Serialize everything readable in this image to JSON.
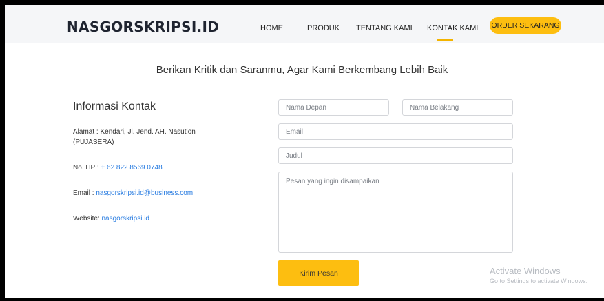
{
  "navbar": {
    "brand": "NASGORSKRIPSI.ID",
    "items": [
      "HOME",
      "PRODUK",
      "TENTANG KAMI",
      "KONTAK KAMI"
    ],
    "active": "KONTAK KAMI",
    "order_label": "ORDER SEKARANG",
    "accent_color": "#fdbe10"
  },
  "heading": "Berikan Kritik dan Saranmu, Agar Kami Berkembang Lebih Baik",
  "contact_info": {
    "title": "Informasi Kontak",
    "address_label": "Alamat : Kendari, Jl. Jend. AH. Nasution",
    "address_line2": "(PUJASERA)",
    "phone_label": "No. HP : ",
    "phone_value": "+ 62 822 8569 0748",
    "email_label": "Email : ",
    "email_value": "nasgorskripsi.id@business.com",
    "website_label": "Website: ",
    "website_value": "nasgorskripsi.id",
    "link_color": "#2a7de1"
  },
  "form": {
    "first_name_placeholder": "Nama Depan",
    "last_name_placeholder": "Nama Belakang",
    "email_placeholder": "Email",
    "subject_placeholder": "Judul",
    "message_placeholder": "Pesan yang ingin disampaikan",
    "submit_label": "Kirim Pesan"
  },
  "watermark": {
    "title": "Activate Windows",
    "subtitle": "Go to Settings to activate Windows."
  }
}
